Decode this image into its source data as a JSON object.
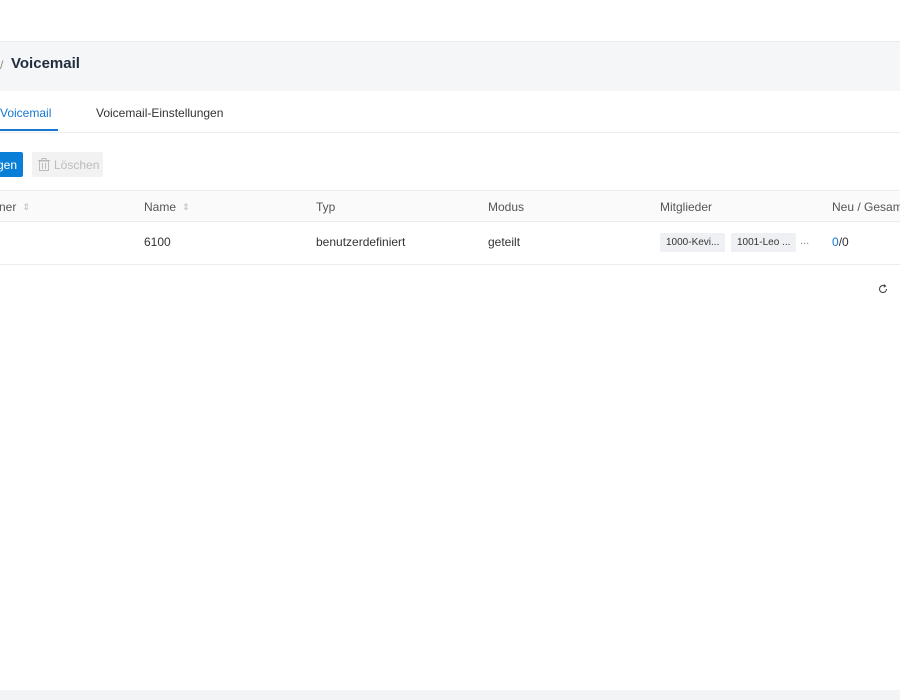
{
  "breadcrumb": {
    "separator": "/",
    "title": "Voicemail"
  },
  "tabs": [
    {
      "label": "Voicemail",
      "active": true
    },
    {
      "label": "Voicemail-Einstellungen",
      "active": false
    }
  ],
  "toolbar": {
    "add_label": "gen",
    "delete_label": "Löschen",
    "delete_icon": "trash-icon"
  },
  "table": {
    "headers": [
      "ner",
      "Name",
      "Typ",
      "Modus",
      "Mitglieder",
      "Neu / Gesamt"
    ],
    "rows": [
      {
        "name": "6100",
        "type": "benutzerdefiniert",
        "mode": "geteilt",
        "members": [
          "1000-Kevi...",
          "1001-Leo ..."
        ],
        "members_more": "...",
        "new": "0",
        "total": "/0"
      }
    ]
  },
  "colors": {
    "accent": "#1677d2",
    "primary_button": "#0a7fd8",
    "breadcrumb_bg": "#f5f6f8"
  }
}
